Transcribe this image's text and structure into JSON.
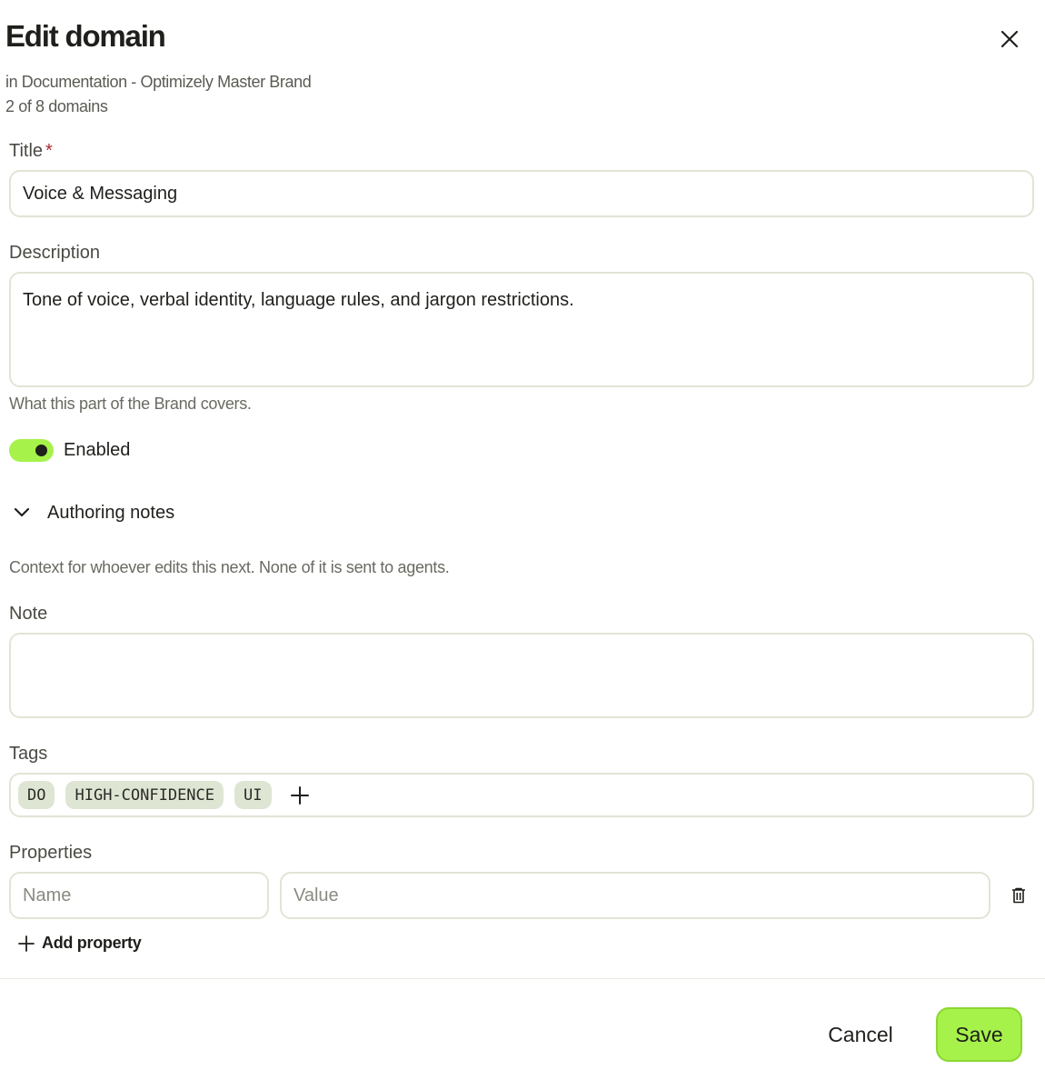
{
  "header": {
    "title": "Edit domain",
    "context": "in Documentation - Optimizely Master Brand",
    "position": "2 of 8 domains",
    "close_icon": "close-icon"
  },
  "form": {
    "title": {
      "label": "Title",
      "required_mark": "*",
      "value": "Voice & Messaging"
    },
    "description": {
      "label": "Description",
      "value": "Tone of voice, verbal identity, language rules, and jargon restrictions.",
      "helper": "What this part of the Brand covers."
    },
    "enabled": {
      "label": "Enabled",
      "on": true,
      "accent": "#a6f24a"
    },
    "authoring_notes": {
      "label": "Authoring notes",
      "expanded": true,
      "helper": "Context for whoever edits this next. None of it is sent to agents."
    },
    "note": {
      "label": "Note",
      "value": ""
    },
    "tags": {
      "label": "Tags",
      "items": [
        "DO",
        "HIGH-CONFIDENCE",
        "UI"
      ]
    },
    "properties": {
      "label": "Properties",
      "name_placeholder": "Name",
      "value_placeholder": "Value",
      "add_label": "Add property"
    }
  },
  "footer": {
    "cancel_label": "Cancel",
    "save_label": "Save",
    "save_color": "#a6f24a"
  }
}
